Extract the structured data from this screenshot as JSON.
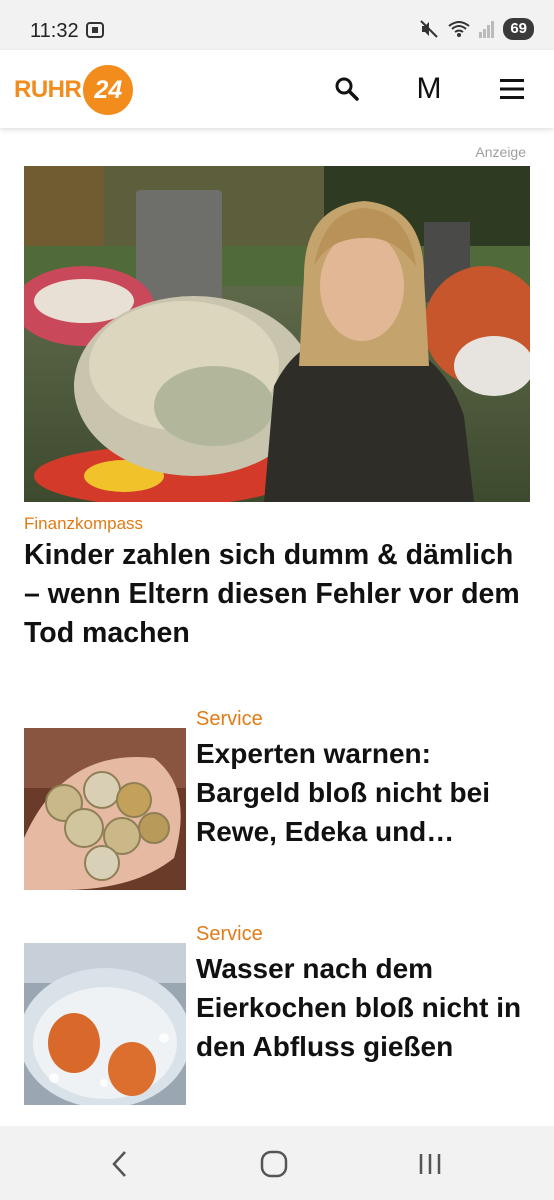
{
  "status": {
    "time": "11:32",
    "battery": "69"
  },
  "header": {
    "logo_text": "RUHR",
    "logo_number": "24",
    "m_label": "M"
  },
  "ad_label": "Anzeige",
  "hero": {
    "category": "Finanzkompass",
    "title": "Kinder zahlen sich dumm & dämlich – wenn Eltern diesen Fehler vor dem Tod machen"
  },
  "articles": [
    {
      "category": "Service",
      "title": "Experten warnen: Bargeld bloß nicht bei Rewe, Edeka und…"
    },
    {
      "category": "Service",
      "title": "Wasser nach dem Eierkochen bloß nicht in den Abfluss gießen"
    }
  ],
  "icons": {
    "search": "search-icon",
    "menu": "hamburger-menu-icon",
    "back": "back-icon",
    "home": "home-icon",
    "recents": "recents-icon"
  },
  "colors": {
    "accent": "#f28c1c",
    "category": "#e07b15"
  }
}
